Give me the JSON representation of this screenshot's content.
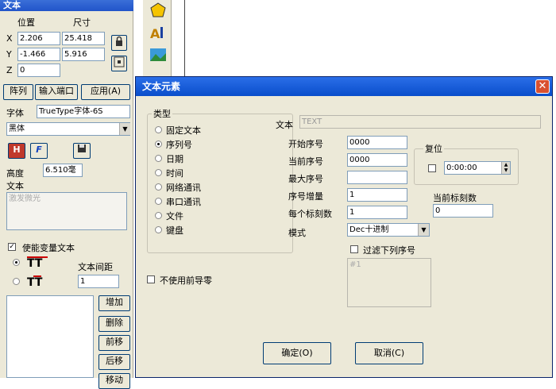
{
  "left_panel": {
    "title": "文本",
    "pos_label": "位置",
    "size_label": "尺寸",
    "x_label": "X",
    "y_label": "Y",
    "z_label": "Z",
    "x_pos": "2.206",
    "y_pos": "-1.466",
    "z_pos": "0",
    "x_size": "25.418",
    "y_size": "5.916",
    "tab_array": "阵列",
    "tab_input": "输入端口",
    "apply_button": "应用(A)",
    "font_label": "字体",
    "font_type": "TrueType字体-6S",
    "font_name": "黑体",
    "height_label": "高度",
    "height_value": "6.510毫",
    "text_label": "文本",
    "text_placeholder": "激发微光",
    "enable_variable": "使能变量文本",
    "text_spacing_label": "文本间距",
    "text_spacing_value": "1",
    "btn_add": "增加",
    "btn_delete": "删除",
    "btn_prev": "前移",
    "btn_next": "后移",
    "btn_cut": "移动"
  },
  "dialog": {
    "title": "文本元素",
    "type_group": "类型",
    "types": [
      "固定文本",
      "序列号",
      "日期",
      "时间",
      "网络通讯",
      "串口通讯",
      "文件",
      "键盘"
    ],
    "selected_type_index": 1,
    "no_leading_zero": "不使用前导零",
    "text_label": "文本",
    "text_value": "TEXT",
    "start_label": "开始序号",
    "start_value": "0000",
    "current_label": "当前序号",
    "current_value": "0000",
    "max_label": "最大序号",
    "max_value": "",
    "increment_label": "序号增量",
    "increment_value": "1",
    "per_mark_label": "每个标刻数",
    "per_mark_value": "1",
    "mode_label": "模式",
    "mode_value": "Dec十进制",
    "reset_group": "复位",
    "reset_time": "0:00:00",
    "current_marks_label": "当前标刻数",
    "current_marks_value": "0",
    "filter_label": "过滤下列序号",
    "filter_value": "#1",
    "ok_button": "确定(O)",
    "cancel_button": "取消(C)"
  }
}
